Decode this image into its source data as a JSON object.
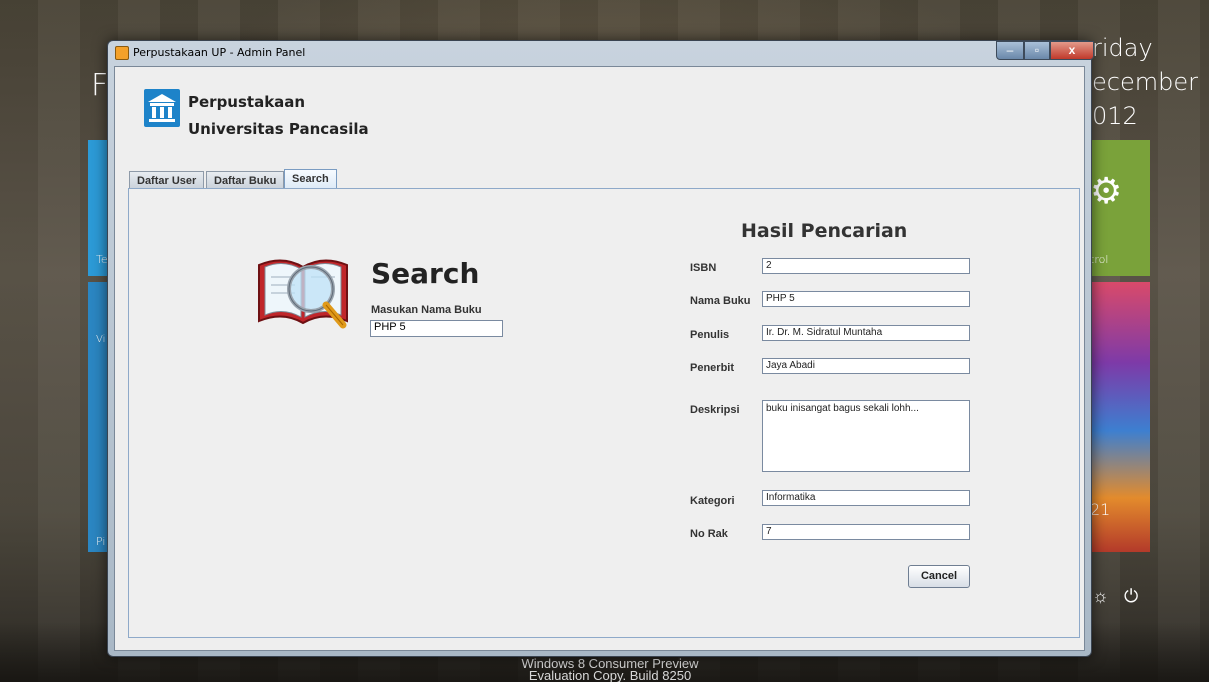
{
  "window": {
    "title": "Perpustakaan UP - Admin Panel",
    "minimize_glyph": "–",
    "maximize_glyph": "▫",
    "close_glyph": "x"
  },
  "header": {
    "line1": "Perpustakaan",
    "line2": "Universitas Pancasila",
    "logo_icon": "university-building-icon"
  },
  "tabs": [
    {
      "label": "Daftar User",
      "active": false
    },
    {
      "label": "Daftar Buku",
      "active": false
    },
    {
      "label": "Search",
      "active": true
    }
  ],
  "search": {
    "title": "Search",
    "label": "Masukan Nama Buku",
    "value": "PHP 5",
    "icon": "book-magnifier-icon"
  },
  "results": {
    "title": "Hasil Pencarian",
    "fields": {
      "isbn": {
        "label": "ISBN",
        "value": "2"
      },
      "nama_buku": {
        "label": "Nama Buku",
        "value": "PHP 5"
      },
      "penulis": {
        "label": "Penulis",
        "value": "Ir. Dr. M. Sidratul Muntaha"
      },
      "penerbit": {
        "label": "Penerbit",
        "value": "Jaya Abadi"
      },
      "deskripsi": {
        "label": "Deskripsi",
        "value": "buku inisangat bagus sekali lohh..."
      },
      "kategori": {
        "label": "Kategori",
        "value": "Informatika"
      },
      "no_rak": {
        "label": "No Rak",
        "value": "7"
      }
    },
    "cancel_label": "Cancel"
  },
  "desktop": {
    "day": "riday",
    "month": "ecember",
    "year": "012",
    "tile_label_1": "trol",
    "tile_left_1": "Te",
    "tile_left_2": "Vi",
    "tile_left_3": "Pi",
    "left_char": "F",
    "tile_num": "21",
    "watermark_line1": "Windows 8 Consumer Preview",
    "watermark_line2": "Evaluation Copy. Build 8250",
    "colors": {
      "green_tile": "#7aa23a",
      "blue_tile": "#2c9ad6",
      "accent": "#1d83c9"
    }
  }
}
